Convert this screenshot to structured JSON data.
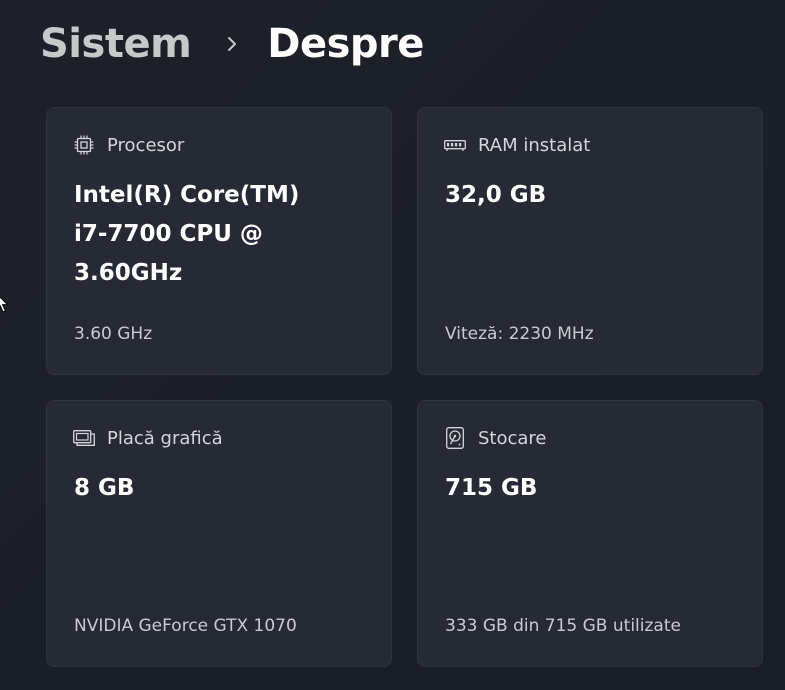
{
  "breadcrumb": {
    "parent": "Sistem",
    "current": "Despre"
  },
  "cards": {
    "processor": {
      "icon": "cpu-icon",
      "title": "Procesor",
      "value": "Intel(R) Core(TM) i7-7700 CPU @ 3.60GHz",
      "sub": "3.60 GHz"
    },
    "ram": {
      "icon": "ram-icon",
      "title": "RAM instalat",
      "value": "32,0 GB",
      "sub": "Viteză: 2230 MHz"
    },
    "gpu": {
      "icon": "gpu-icon",
      "title": "Placă grafică",
      "value": "8 GB",
      "sub": "NVIDIA GeForce GTX 1070"
    },
    "storage": {
      "icon": "storage-icon",
      "title": "Stocare",
      "value": "715 GB",
      "sub": "333 GB din 715 GB utilizate"
    }
  },
  "colors": {
    "background": "#1c2029",
    "card": "#262a35",
    "text_primary": "#ffffff",
    "text_secondary": "#c9cbd0"
  }
}
